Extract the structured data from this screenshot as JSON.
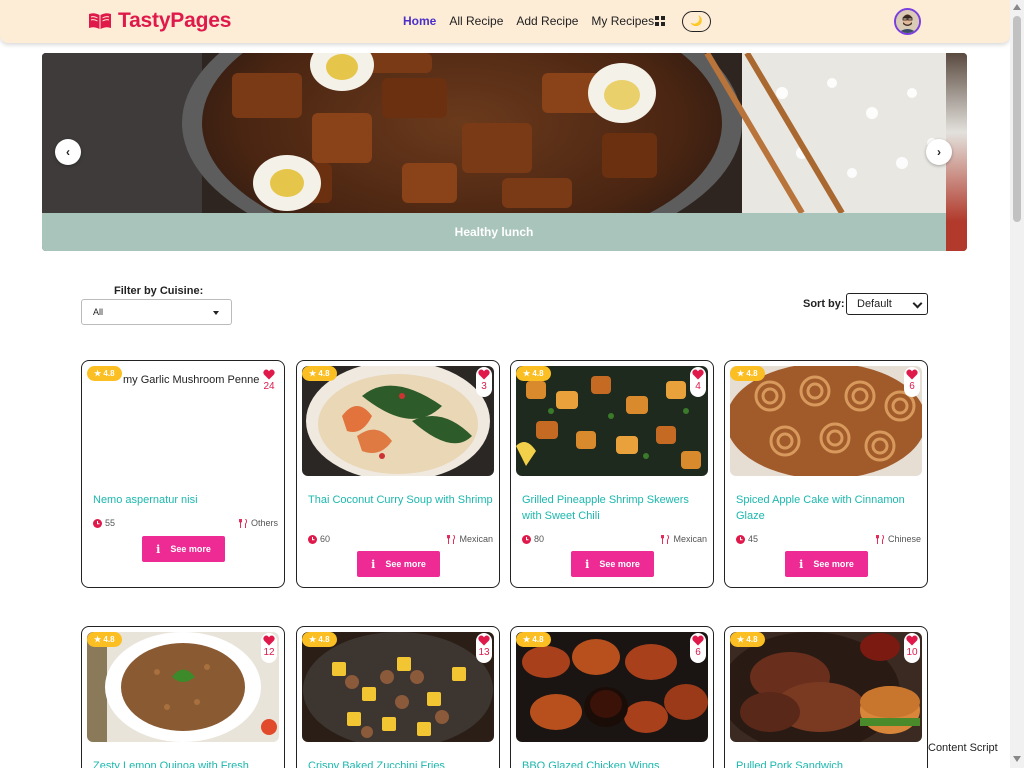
{
  "nav": {
    "brand": "TastyPages",
    "links": [
      "Home",
      "All Recipe",
      "Add Recipe",
      "My Recipes"
    ],
    "theme_icon": "🌙"
  },
  "hero": {
    "caption": "Healthy lunch",
    "prev": "‹",
    "next": "›"
  },
  "filters": {
    "cuisine_label": "Filter by Cuisine:",
    "cuisine_value": "All",
    "sort_label": "Sort by:",
    "sort_value": "Default"
  },
  "see_more_label": "See more",
  "recipes": [
    {
      "alt": "my Garlic Mushroom Penne Pa",
      "rating": "★ 4.8",
      "likes": "24",
      "title": "Nemo aspernatur nisi",
      "time": "55",
      "cuisine": "Others"
    },
    {
      "rating": "★ 4.8",
      "likes": "3",
      "title": "Thai Coconut Curry Soup with Shrimp",
      "time": "60",
      "cuisine": "Mexican"
    },
    {
      "rating": "★ 4.8",
      "likes": "4",
      "title": "Grilled Pineapple Shrimp Skewers with Sweet Chili",
      "time": "80",
      "cuisine": "Mexican"
    },
    {
      "rating": "★ 4.8",
      "likes": "6",
      "title": "Spiced Apple Cake with Cinnamon Glaze",
      "time": "45",
      "cuisine": "Chinese"
    },
    {
      "rating": "★ 4.8",
      "likes": "12",
      "title": "Zesty Lemon Quinoa with Fresh"
    },
    {
      "rating": "★ 4.8",
      "likes": "13",
      "title": "Crispy Baked Zucchini Fries"
    },
    {
      "rating": "★ 4.8",
      "likes": "6",
      "title": "BBQ Glazed Chicken Wings"
    },
    {
      "rating": "★ 4.8",
      "likes": "10",
      "title": "Pulled Pork Sandwich"
    }
  ],
  "footer_note": "Content Script",
  "colors": {
    "brand": "#e0194b",
    "nav_bg": "#fdecd6",
    "accent_title": "#1cb8ae",
    "button": "#ee2b94",
    "rating": "#fbbf24",
    "active_link": "#4b2fc9"
  }
}
